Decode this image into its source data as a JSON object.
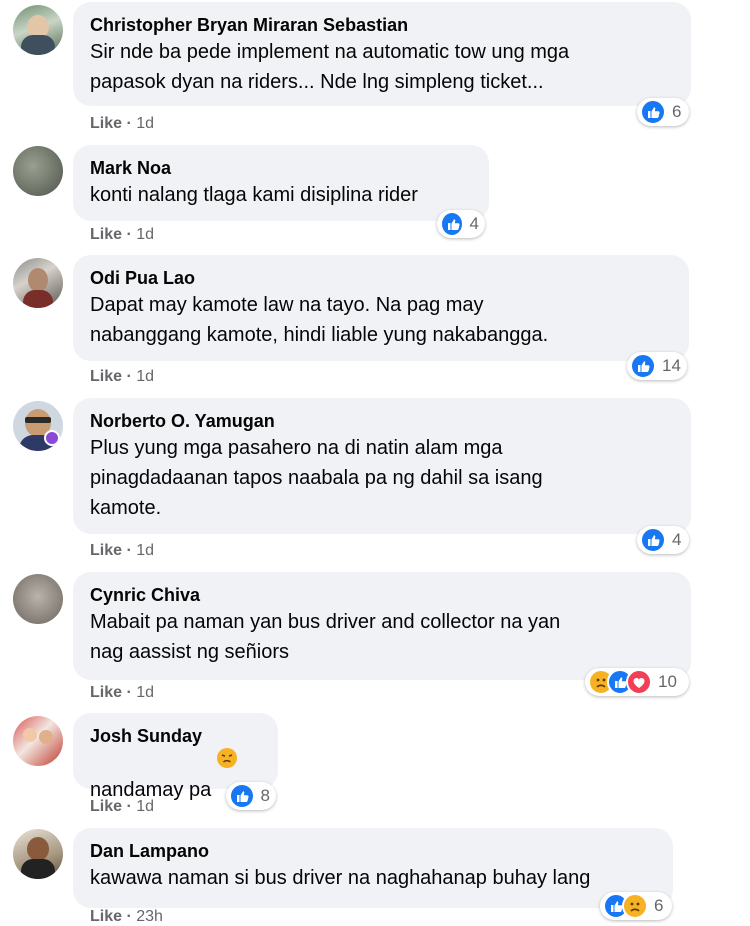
{
  "actions": {
    "like_label": "Like",
    "separator": "·"
  },
  "comments": [
    {
      "author": "Christopher Bryan Miraran Sebastian",
      "text": "Sir nde ba pede implement na automatic tow ung mga\npapasok dyan na riders... Nde lng simpleng ticket...",
      "time": "1d",
      "reaction_count": "6",
      "reactions": [
        "like-icon"
      ]
    },
    {
      "author": "Mark Noa",
      "text": "konti nalang tlaga kami disiplina rider",
      "time": "1d",
      "reaction_count": "4",
      "reactions": [
        "like-icon"
      ]
    },
    {
      "author": "Odi Pua Lao",
      "text": "Dapat may kamote law na tayo. Na pag may\nnabanggang kamote, hindi liable yung nakabangga.",
      "time": "1d",
      "reaction_count": "14",
      "reactions": [
        "like-icon"
      ]
    },
    {
      "author": "Norberto O. Yamugan",
      "text": "Plus yung mga pasahero na di natin alam mga\npinagdadaanan tapos naabala pa ng dahil sa isang\nkamote.",
      "time": "1d",
      "reaction_count": "4",
      "reactions": [
        "like-icon"
      ]
    },
    {
      "author": "Cynric Chiva",
      "text": "Mabait pa naman yan bus driver and collector na yan\nnag aassist ng señiors",
      "time": "1d",
      "reaction_count": "10",
      "reactions": [
        "sad-icon",
        "like-icon",
        "love-icon"
      ]
    },
    {
      "author": "Josh Sunday",
      "text": "nandamay pa",
      "time": "1d",
      "reaction_count": "8",
      "reactions": [
        "like-icon"
      ],
      "emoji": "angry-face-icon"
    },
    {
      "author": "Dan Lampano",
      "text": "kawawa naman si bus driver na naghahanap buhay lang",
      "time": "23h",
      "reaction_count": "6",
      "reactions": [
        "like-icon",
        "sad-icon"
      ]
    }
  ],
  "colors": {
    "bubble": "#f0f2f5",
    "meta_text": "#65676b",
    "like_blue": "#1877f2",
    "love_red": "#f33e58",
    "sad_yellow": "#f7b125"
  }
}
